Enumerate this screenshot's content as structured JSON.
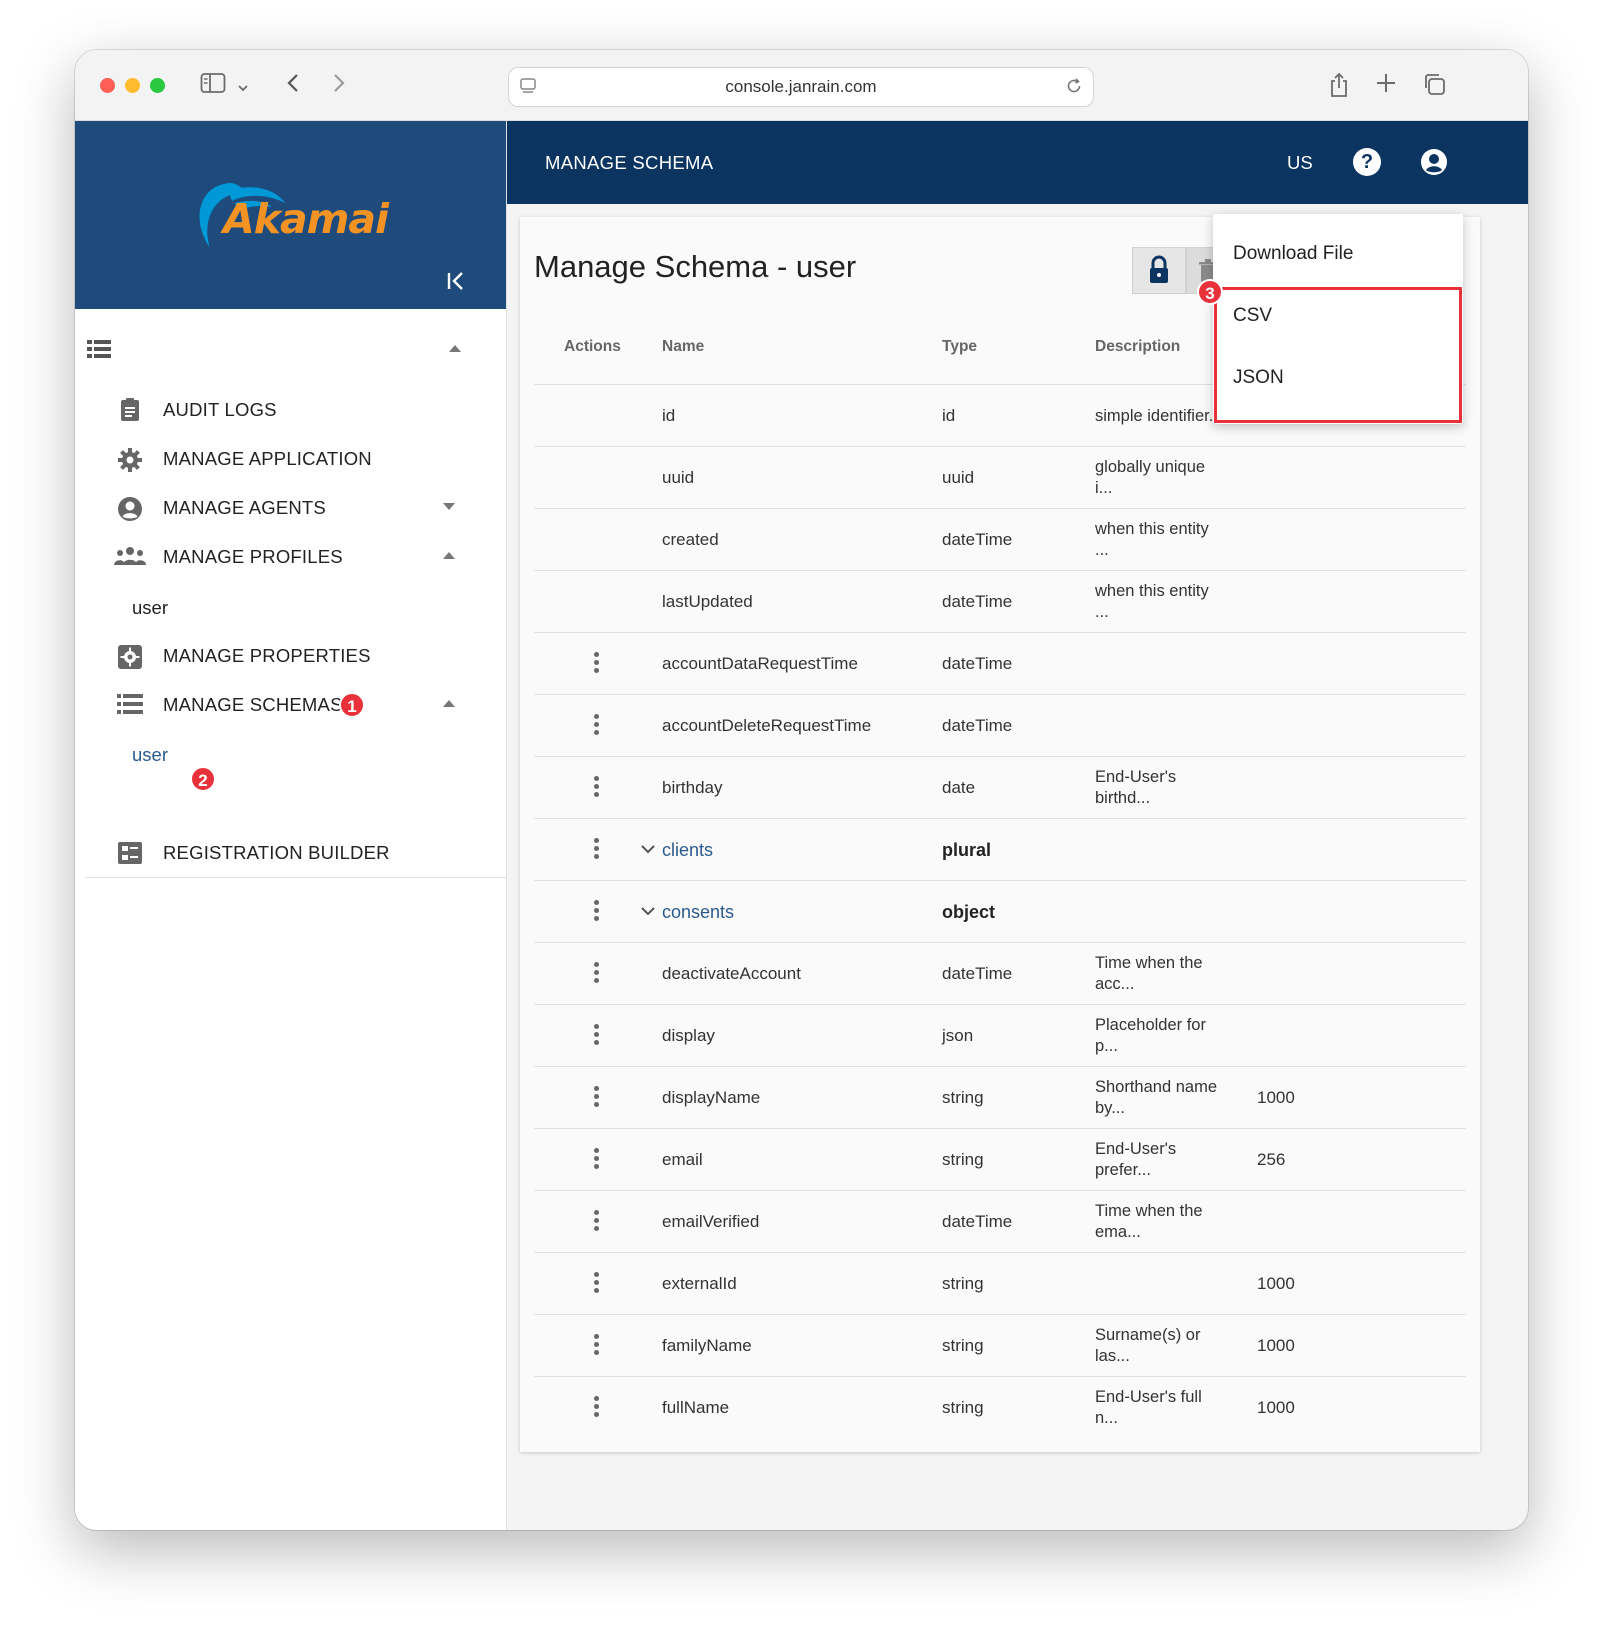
{
  "browser": {
    "url": "console.janrain.com"
  },
  "brand": {
    "logo_text": "Akamai",
    "colors": {
      "primary_dark": "#0b3560",
      "sidebar_head": "#1e4a7c",
      "accent": "#f39324",
      "link": "#2a5a8c",
      "badge": "#e8313a"
    }
  },
  "header": {
    "title": "MANAGE SCHEMA",
    "region": "US",
    "help_symbol": "?"
  },
  "sidebar": {
    "items": [
      {
        "label": "AUDIT LOGS",
        "icon": "clipboard-icon"
      },
      {
        "label": "MANAGE APPLICATION",
        "icon": "gear-icon"
      },
      {
        "label": "MANAGE AGENTS",
        "icon": "account-circle-icon"
      },
      {
        "label": "MANAGE PROFILES",
        "icon": "people-icon"
      },
      {
        "label": "user"
      },
      {
        "label": "MANAGE PROPERTIES",
        "icon": "settings-box-icon"
      },
      {
        "label": "MANAGE SCHEMAS",
        "icon": "list-icon"
      },
      {
        "label": "user"
      },
      {
        "label": "REGISTRATION BUILDER",
        "icon": "form-icon"
      }
    ],
    "badges": [
      "1",
      "2"
    ]
  },
  "page": {
    "title": "Manage Schema - user"
  },
  "table": {
    "headers": [
      "Actions",
      "Name",
      "Type",
      "Description"
    ],
    "rows": [
      {
        "name": "id",
        "type": "id",
        "desc": "simple identifier...",
        "length": "",
        "actions": false,
        "group": false
      },
      {
        "name": "uuid",
        "type": "uuid",
        "desc": "globally unique i...",
        "length": "",
        "actions": false,
        "group": false
      },
      {
        "name": "created",
        "type": "dateTime",
        "desc": "when this entity ...",
        "length": "",
        "actions": false,
        "group": false
      },
      {
        "name": "lastUpdated",
        "type": "dateTime",
        "desc": "when this entity ...",
        "length": "",
        "actions": false,
        "group": false
      },
      {
        "name": "accountDataRequestTime",
        "type": "dateTime",
        "desc": "",
        "length": "",
        "actions": true,
        "group": false
      },
      {
        "name": "accountDeleteRequestTime",
        "type": "dateTime",
        "desc": "",
        "length": "",
        "actions": true,
        "group": false
      },
      {
        "name": "birthday",
        "type": "date",
        "desc": "End-User's birthd...",
        "length": "",
        "actions": true,
        "group": false
      },
      {
        "name": "clients",
        "type": "plural",
        "desc": "",
        "length": "",
        "actions": true,
        "group": true
      },
      {
        "name": "consents",
        "type": "object",
        "desc": "",
        "length": "",
        "actions": true,
        "group": true
      },
      {
        "name": "deactivateAccount",
        "type": "dateTime",
        "desc": "Time when the acc...",
        "length": "",
        "actions": true,
        "group": false
      },
      {
        "name": "display",
        "type": "json",
        "desc": "Placeholder for p...",
        "length": "",
        "actions": true,
        "group": false
      },
      {
        "name": "displayName",
        "type": "string",
        "desc": "Shorthand name by...",
        "length": "1000",
        "actions": true,
        "group": false
      },
      {
        "name": "email",
        "type": "string",
        "desc": "End-User's prefer...",
        "length": "256",
        "actions": true,
        "group": false
      },
      {
        "name": "emailVerified",
        "type": "dateTime",
        "desc": "Time when the ema...",
        "length": "",
        "actions": true,
        "group": false
      },
      {
        "name": "externalId",
        "type": "string",
        "desc": "",
        "length": "1000",
        "actions": true,
        "group": false
      },
      {
        "name": "familyName",
        "type": "string",
        "desc": "Surname(s) or las...",
        "length": "1000",
        "actions": true,
        "group": false
      },
      {
        "name": "fullName",
        "type": "string",
        "desc": "End-User's full n...",
        "length": "1000",
        "actions": true,
        "group": false
      }
    ]
  },
  "download_menu": {
    "header": "Download File",
    "options": [
      "CSV",
      "JSON"
    ],
    "badge": "3"
  }
}
